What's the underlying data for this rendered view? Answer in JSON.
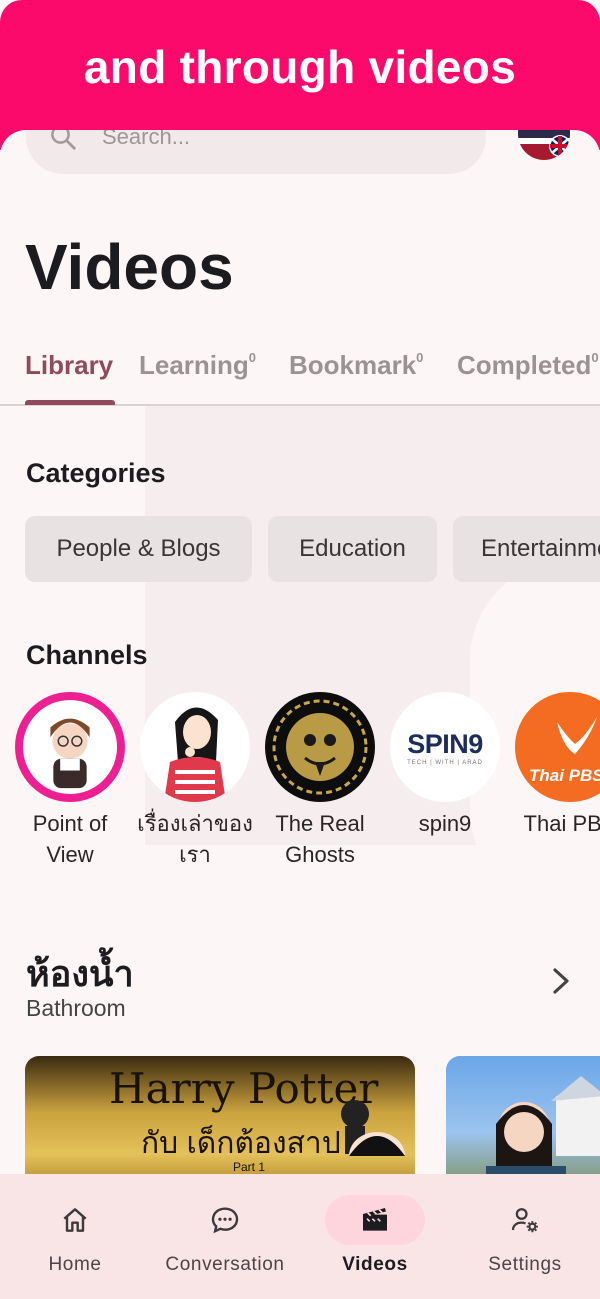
{
  "banner": {
    "text": "and through videos"
  },
  "search": {
    "placeholder": "Search..."
  },
  "page": {
    "title": "Videos"
  },
  "tabs": [
    {
      "label": "Library",
      "count": ""
    },
    {
      "label": "Learning",
      "count": "0"
    },
    {
      "label": "Bookmark",
      "count": "0"
    },
    {
      "label": "Completed",
      "count": "0"
    }
  ],
  "categories": {
    "heading": "Categories",
    "items": [
      "People & Blogs",
      "Education",
      "Entertainment"
    ]
  },
  "channels": {
    "heading": "Channels",
    "items": [
      {
        "name": "Point of View",
        "logo_text": "Point of View"
      },
      {
        "name": "เรื่องเล่าของเรา",
        "logo_text": ""
      },
      {
        "name": "The Real Ghosts",
        "logo_text": ""
      },
      {
        "name": "spin9",
        "logo_text": "SPIN9",
        "logo_sub": "TECH | WITH | ARAD"
      },
      {
        "name": "Thai PBS",
        "logo_text": "Thai PBS"
      }
    ]
  },
  "section": {
    "title": "ห้องน้ำ",
    "subtitle": "Bathroom",
    "videos": [
      {
        "thumb_title": "Harry Potter",
        "thumb_subtitle": "กับ เด็กต้องสาป",
        "thumb_part": "Part 1"
      },
      {
        "thumb_title": ""
      }
    ]
  },
  "nav": {
    "items": [
      {
        "label": "Home",
        "icon": "home-icon"
      },
      {
        "label": "Conversation",
        "icon": "chat-icon"
      },
      {
        "label": "Videos",
        "icon": "clapperboard-icon"
      },
      {
        "label": "Settings",
        "icon": "user-settings-icon"
      }
    ],
    "active": "Videos"
  },
  "colors": {
    "banner": "#fb0a6b",
    "accent": "#8f4a5c",
    "background": "#fdf6f6",
    "nav_background": "#f9e4e6",
    "nav_active_pill": "#ffd5dd",
    "chip_background": "#e8e2e2"
  }
}
